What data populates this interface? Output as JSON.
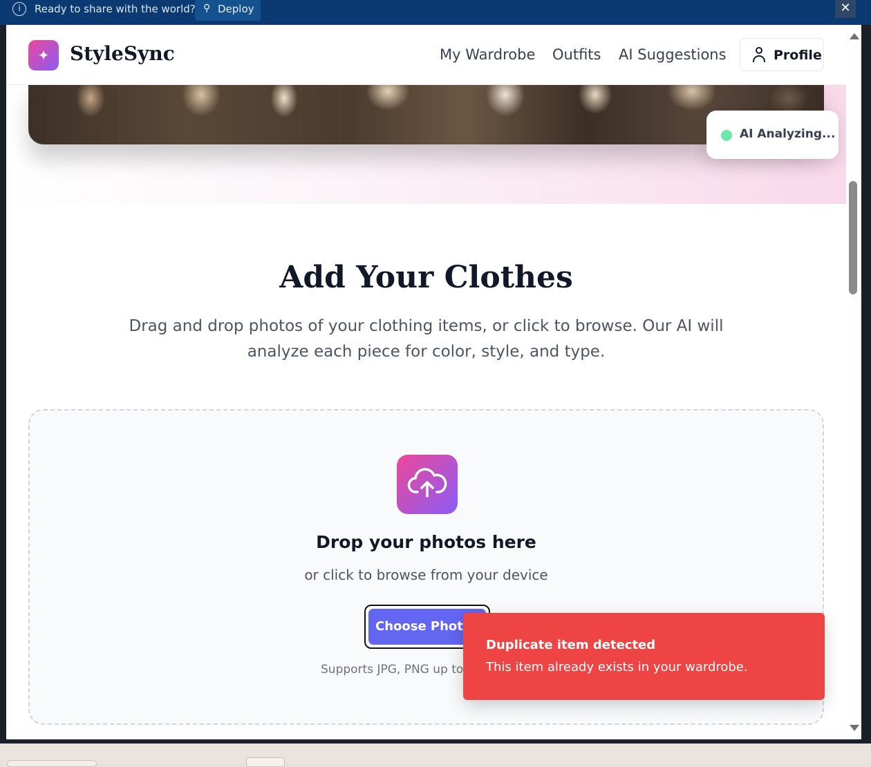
{
  "banner": {
    "message": "Ready to share with the world?",
    "deploy_label": "Deploy",
    "close_glyph": "✕"
  },
  "header": {
    "logo_glyph": "✦",
    "brand": "StyleSync",
    "nav": [
      "My Wardrobe",
      "Outfits",
      "AI Suggestions"
    ],
    "profile_label": "Profile"
  },
  "hero": {
    "status_label": "AI Analyzing..."
  },
  "section": {
    "title": "Add Your Clothes",
    "description": "Drag and drop photos of your clothing items, or click to browse. Our AI will analyze each piece for color, style, and type."
  },
  "dropzone": {
    "title": "Drop your photos here",
    "subtitle": "or click to browse from your device",
    "button_label": "Choose Photos",
    "supports_text": "Supports JPG, PNG up to"
  },
  "toast": {
    "title": "Duplicate item detected",
    "message": "This item already exists in your wardrobe."
  },
  "colors": {
    "banner": "#0b3a73",
    "accent_gradient_start": "#ec4899",
    "accent_gradient_end": "#8b5cf6",
    "primary_button": "#6366f1",
    "toast_error": "#ef4444",
    "status_dot": "#6ee7a8"
  },
  "icons": {
    "banner_info": "info-icon",
    "deploy": "rocket-icon",
    "logo": "sparkle-icon",
    "profile": "user-icon",
    "upload": "cloud-upload-icon"
  }
}
